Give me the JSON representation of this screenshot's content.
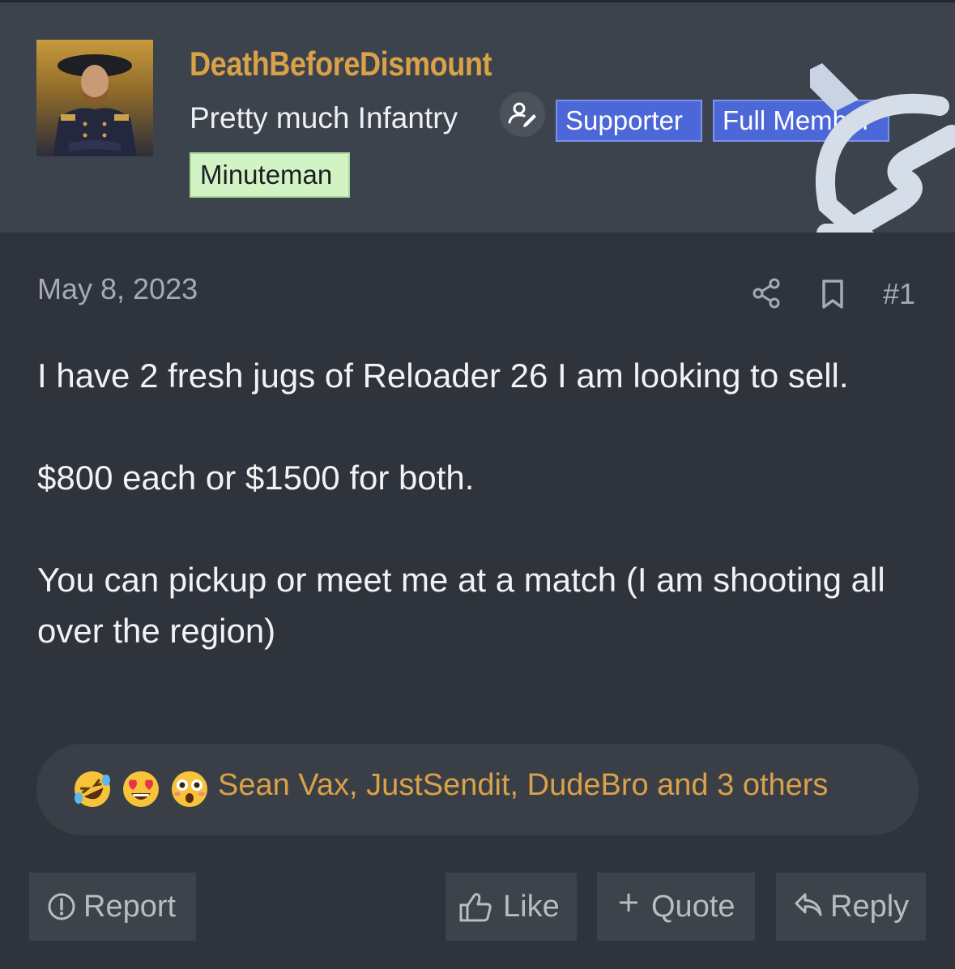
{
  "user": {
    "username": "DeathBeforeDismount",
    "title": "Pretty much Infantry",
    "badges": [
      "Supporter",
      "Full Member"
    ],
    "rank": "Minuteman"
  },
  "post": {
    "date": "May 8, 2023",
    "number": "#1",
    "paragraphs": [
      "I have 2 fresh jugs of Reloader 26 I am looking to sell.",
      "$800 each or $1500 for both.",
      "You can pickup or meet me at a match (I am shooting all over the region)"
    ]
  },
  "reactions": {
    "emojis": [
      "rolling-laughing-emoji",
      "heart-eyes-emoji",
      "flushed-emoji"
    ],
    "text": "Sean Vax, JustSendit, DudeBro and 3 others"
  },
  "actions": {
    "report": "Report",
    "like": "Like",
    "quote": "Quote",
    "reply": "Reply"
  },
  "colors": {
    "username": "#d9a148",
    "supporter_badge": "#4c67d8",
    "minuteman_badge": "#d2f4c4",
    "header_bg": "#3d434c",
    "body_bg": "#2f333b"
  },
  "icons": {
    "edit": "user-edit-icon",
    "share": "share-icon",
    "bookmark": "bookmark-icon",
    "report": "exclamation-circle-icon",
    "like": "thumbs-up-icon",
    "quote": "plus-icon",
    "reply": "reply-arrow-icon"
  }
}
